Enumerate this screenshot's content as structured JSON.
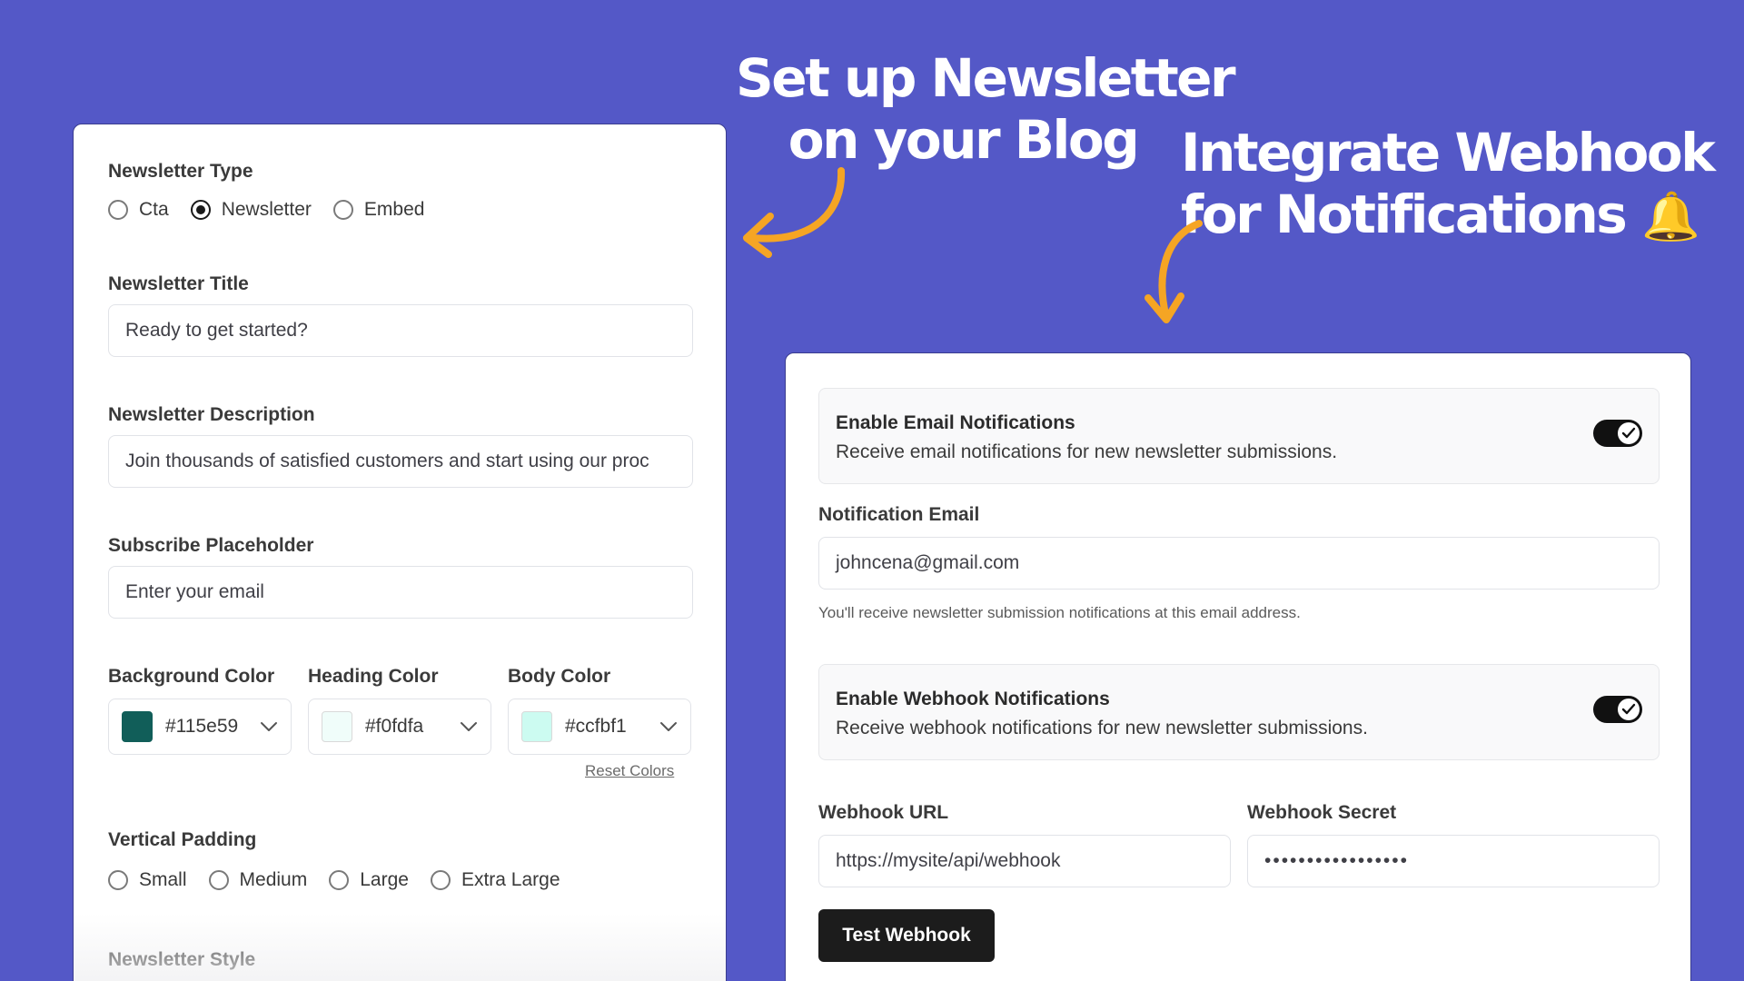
{
  "headlines": {
    "left": [
      "Set up Newsletter",
      "on your Blog"
    ],
    "right": [
      "Integrate Webhook",
      "for Notifications"
    ],
    "right_emoji": "🔔"
  },
  "left_panel": {
    "newsletter_type": {
      "label": "Newsletter Type",
      "options": [
        "Cta",
        "Newsletter",
        "Embed"
      ],
      "selected": "Newsletter"
    },
    "title": {
      "label": "Newsletter Title",
      "value": "Ready to get started?"
    },
    "description": {
      "label": "Newsletter Description",
      "value": "Join thousands of satisfied customers and start using our proc"
    },
    "subscribe_placeholder": {
      "label": "Subscribe Placeholder",
      "value": "Enter your email"
    },
    "colors": [
      {
        "label": "Background Color",
        "value": "#115e59",
        "swatch": "#115e59"
      },
      {
        "label": "Heading Color",
        "value": "#f0fdfa",
        "swatch": "#f0fdfa"
      },
      {
        "label": "Body Color",
        "value": "#ccfbf1",
        "swatch": "#ccfbf1"
      }
    ],
    "reset_colors": "Reset Colors",
    "vertical_padding": {
      "label": "Vertical Padding",
      "options": [
        "Small",
        "Medium",
        "Large",
        "Extra Large"
      ]
    },
    "newsletter_style": {
      "label": "Newsletter Style"
    }
  },
  "right_panel": {
    "email_notifications": {
      "title": "Enable Email Notifications",
      "description": "Receive email notifications for new newsletter submissions.",
      "enabled": true
    },
    "notification_email": {
      "label": "Notification Email",
      "value": "johncena@gmail.com",
      "hint": "You'll receive newsletter submission notifications at this email address."
    },
    "webhook_notifications": {
      "title": "Enable Webhook Notifications",
      "description": "Receive webhook notifications for new newsletter submissions.",
      "enabled": true
    },
    "webhook_url": {
      "label": "Webhook URL",
      "value": "https://mysite/api/webhook"
    },
    "webhook_secret": {
      "label": "Webhook Secret",
      "value": "•••••••••••••••••"
    },
    "test_button": "Test Webhook"
  },
  "colors": {
    "background": "#5458c7",
    "arrow": "#f5a524",
    "toggle_on": "#111111"
  }
}
